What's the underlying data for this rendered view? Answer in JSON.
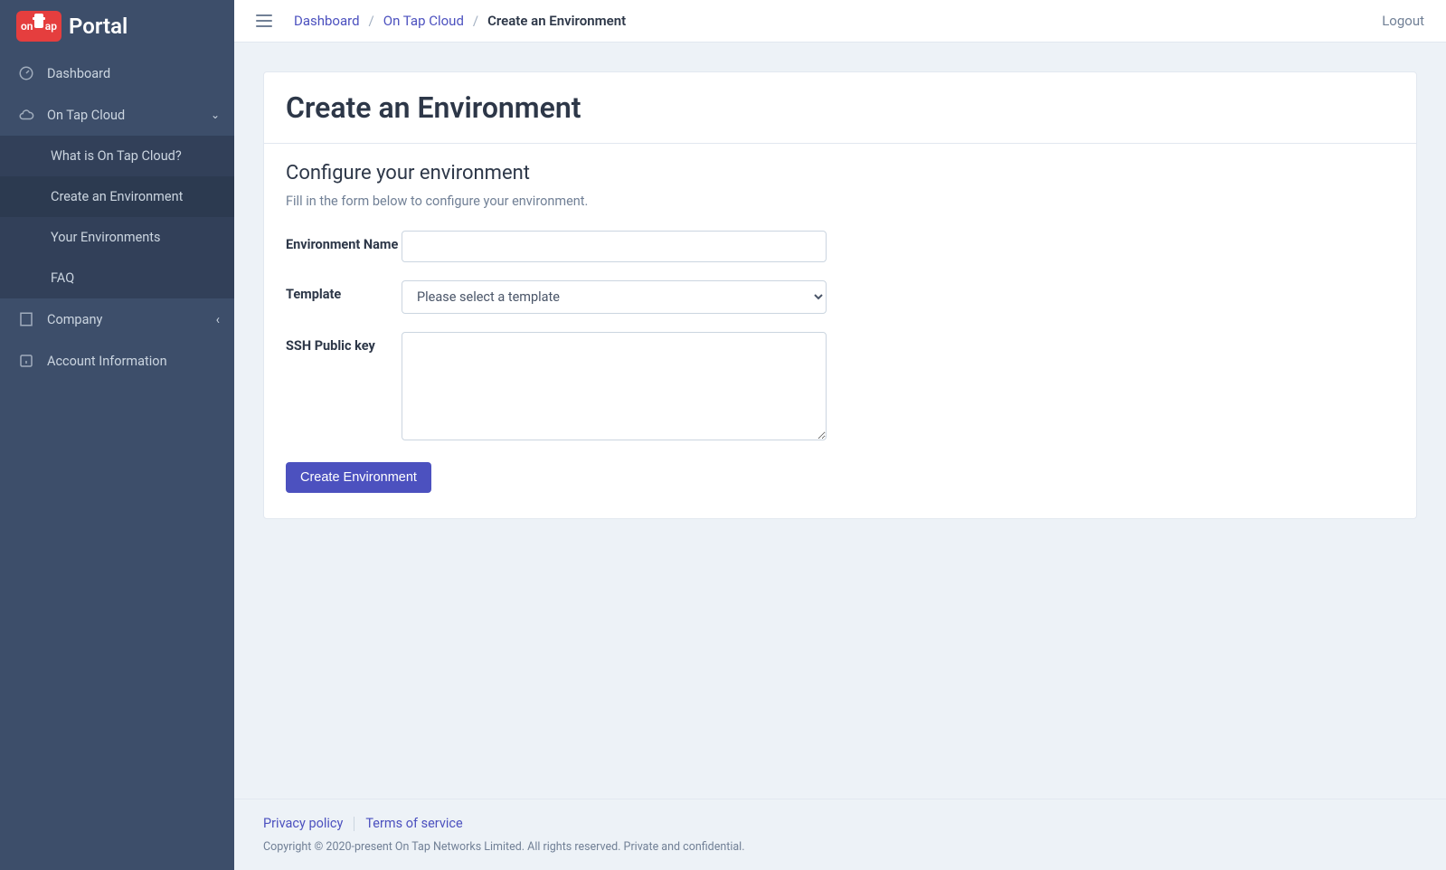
{
  "brand": {
    "text": "Portal"
  },
  "sidebar": {
    "items": [
      {
        "label": "Dashboard"
      },
      {
        "label": "On Tap Cloud"
      },
      {
        "label": "Company"
      },
      {
        "label": "Account Information"
      }
    ],
    "cloudSubmenu": [
      {
        "label": "What is On Tap Cloud?"
      },
      {
        "label": "Create an Environment"
      },
      {
        "label": "Your Environments"
      },
      {
        "label": "FAQ"
      }
    ]
  },
  "topbar": {
    "breadcrumb": [
      {
        "label": "Dashboard"
      },
      {
        "label": "On Tap Cloud"
      },
      {
        "label": "Create an Environment"
      }
    ],
    "logout": "Logout"
  },
  "page": {
    "title": "Create an Environment",
    "sectionTitle": "Configure your environment",
    "sectionDesc": "Fill in the form below to configure your environment.",
    "form": {
      "envNameLabel": "Environment Name",
      "envNameValue": "",
      "templateLabel": "Template",
      "templatePlaceholder": "Please select a template",
      "sshLabel": "SSH Public key",
      "sshValue": "",
      "submitLabel": "Create Environment"
    }
  },
  "footer": {
    "privacy": "Privacy policy",
    "terms": "Terms of service",
    "copyright": "Copyright © 2020-present On Tap Networks Limited. All rights reserved. Private and confidential."
  }
}
